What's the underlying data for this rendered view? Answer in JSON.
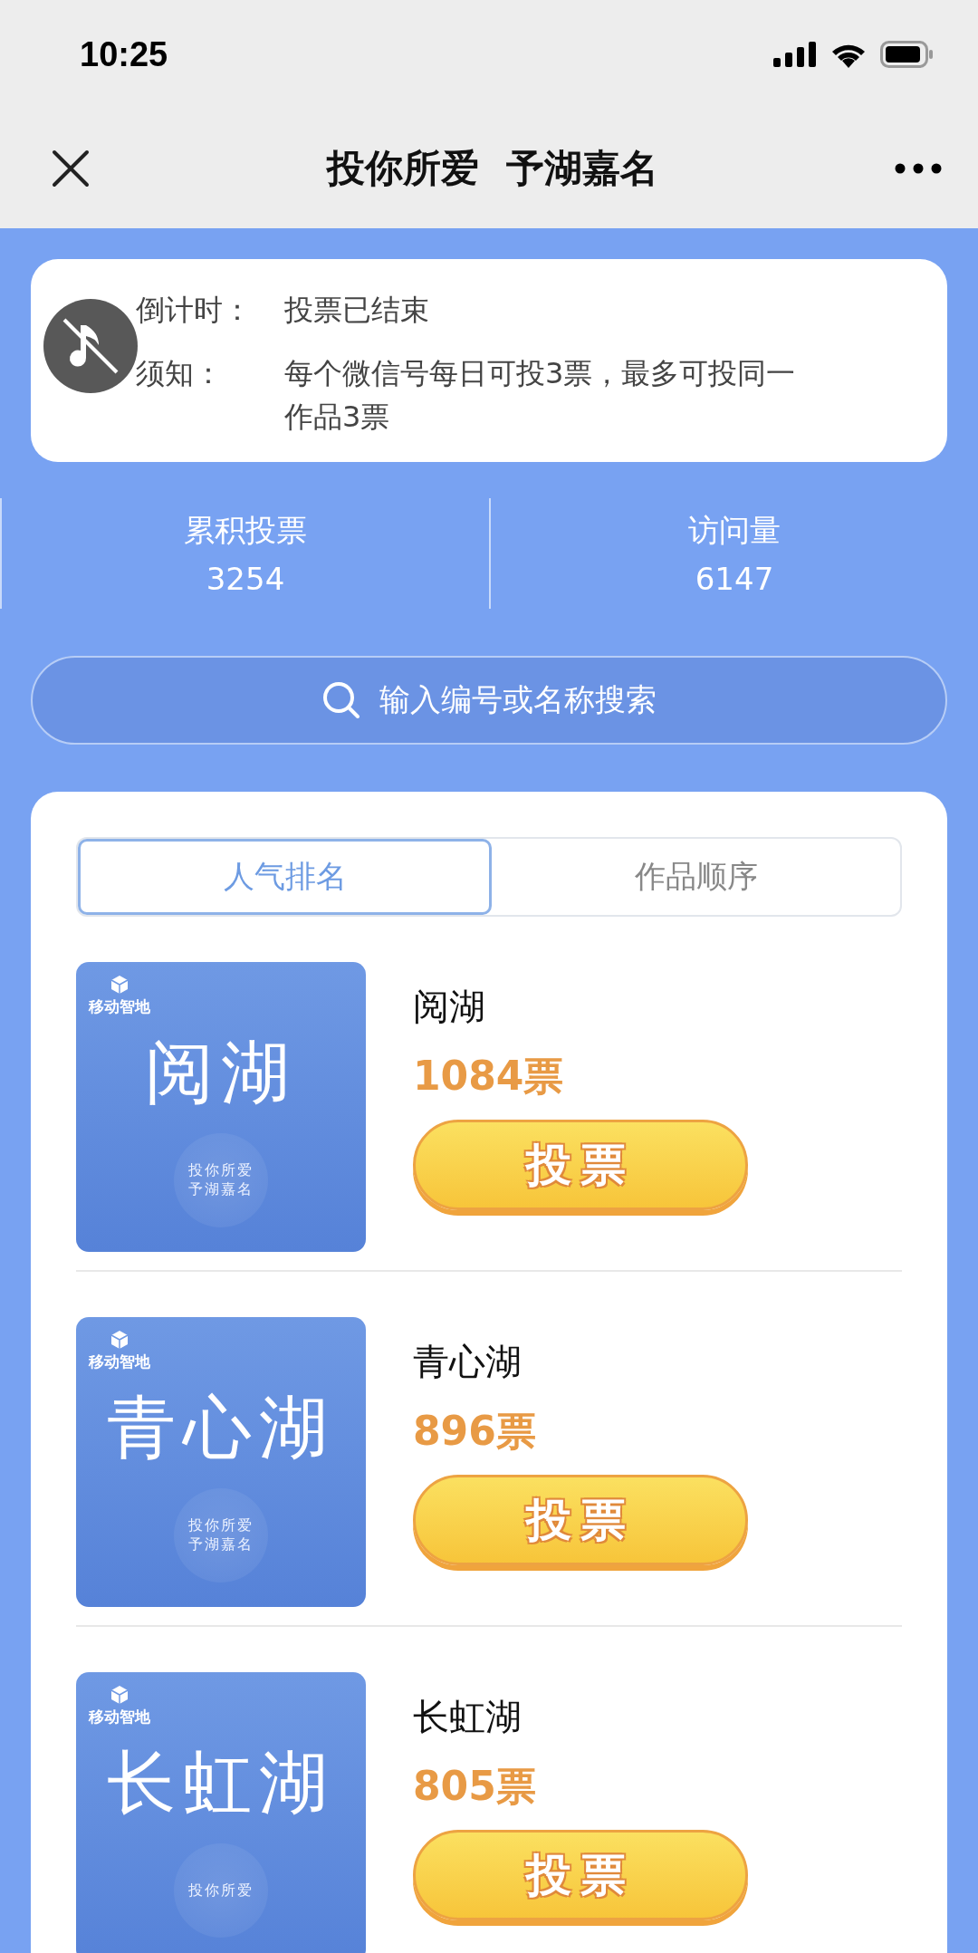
{
  "status_bar": {
    "time": "10:25"
  },
  "nav": {
    "title": "投你所爱  予湖嘉名"
  },
  "info": [
    {
      "label": "倒计时：",
      "value": "投票已结束"
    },
    {
      "label": "须知：",
      "value": "每个微信号每日可投3票，最多可投同一作品3票"
    }
  ],
  "music_button": {
    "muted": true
  },
  "stats": [
    {
      "label": "累积投票",
      "value": "3254"
    },
    {
      "label": "访问量",
      "value": "6147"
    }
  ],
  "search": {
    "placeholder": "输入编号或名称搜索"
  },
  "tabs": [
    {
      "label": "人气排名",
      "selected": true
    },
    {
      "label": "作品顺序",
      "selected": false
    }
  ],
  "entries": [
    {
      "cover": {
        "logo": "移动智地",
        "title": "阅湖",
        "tagline": [
          "投你所爱",
          "予湖嘉名"
        ]
      },
      "name": "阅湖",
      "votes": "1084票",
      "button": "投票"
    },
    {
      "cover": {
        "logo": "移动智地",
        "title": "青心湖",
        "tagline": [
          "投你所爱",
          "予湖嘉名"
        ]
      },
      "name": "青心湖",
      "votes": "896票",
      "button": "投票"
    },
    {
      "cover": {
        "logo": "移动智地",
        "title": "长虹湖",
        "tagline": [
          "投你所爱"
        ]
      },
      "name": "长虹湖",
      "votes": "805票",
      "button": "投票"
    }
  ]
}
